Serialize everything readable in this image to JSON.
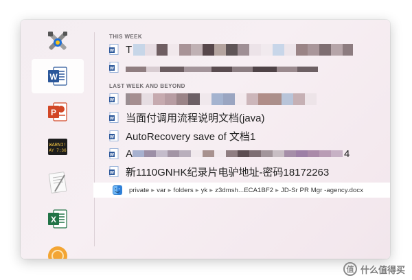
{
  "dock": {
    "apps": [
      {
        "name": "system-tools",
        "selected": false
      },
      {
        "name": "microsoft-word",
        "selected": true
      },
      {
        "name": "microsoft-powerpoint",
        "selected": false
      },
      {
        "name": "console",
        "selected": false,
        "text_top": "WARNI!",
        "text_bottom": "AY 7:36"
      },
      {
        "name": "textedit",
        "selected": false
      },
      {
        "name": "microsoft-excel",
        "selected": false
      },
      {
        "name": "partial-app",
        "selected": false
      }
    ]
  },
  "recents": {
    "this_week_title": "THIS WEEK",
    "last_week_title": "LAST WEEK AND BEYOND",
    "doc1_prefix": "T",
    "doc4_label": "当面付调用流程说明文档(java)",
    "doc5_label": "AutoRecovery save of 文档1",
    "doc6_prefix": "A",
    "doc6_suffix": "4",
    "doc7_label": "新1110GNHK纪录片电驴地址-密码18172263"
  },
  "path": {
    "segments": [
      "private",
      "var",
      "folders",
      "yk",
      "z3dmsh...ECA1BF2",
      "JD-Sr PR Mgr -agency.docx"
    ],
    "separator": "▸"
  },
  "watermark": {
    "logo": "值",
    "text": "什么值得买"
  },
  "colors": {
    "word_blue": "#2b579a",
    "ppt_red": "#d24726",
    "excel_green": "#217346"
  }
}
